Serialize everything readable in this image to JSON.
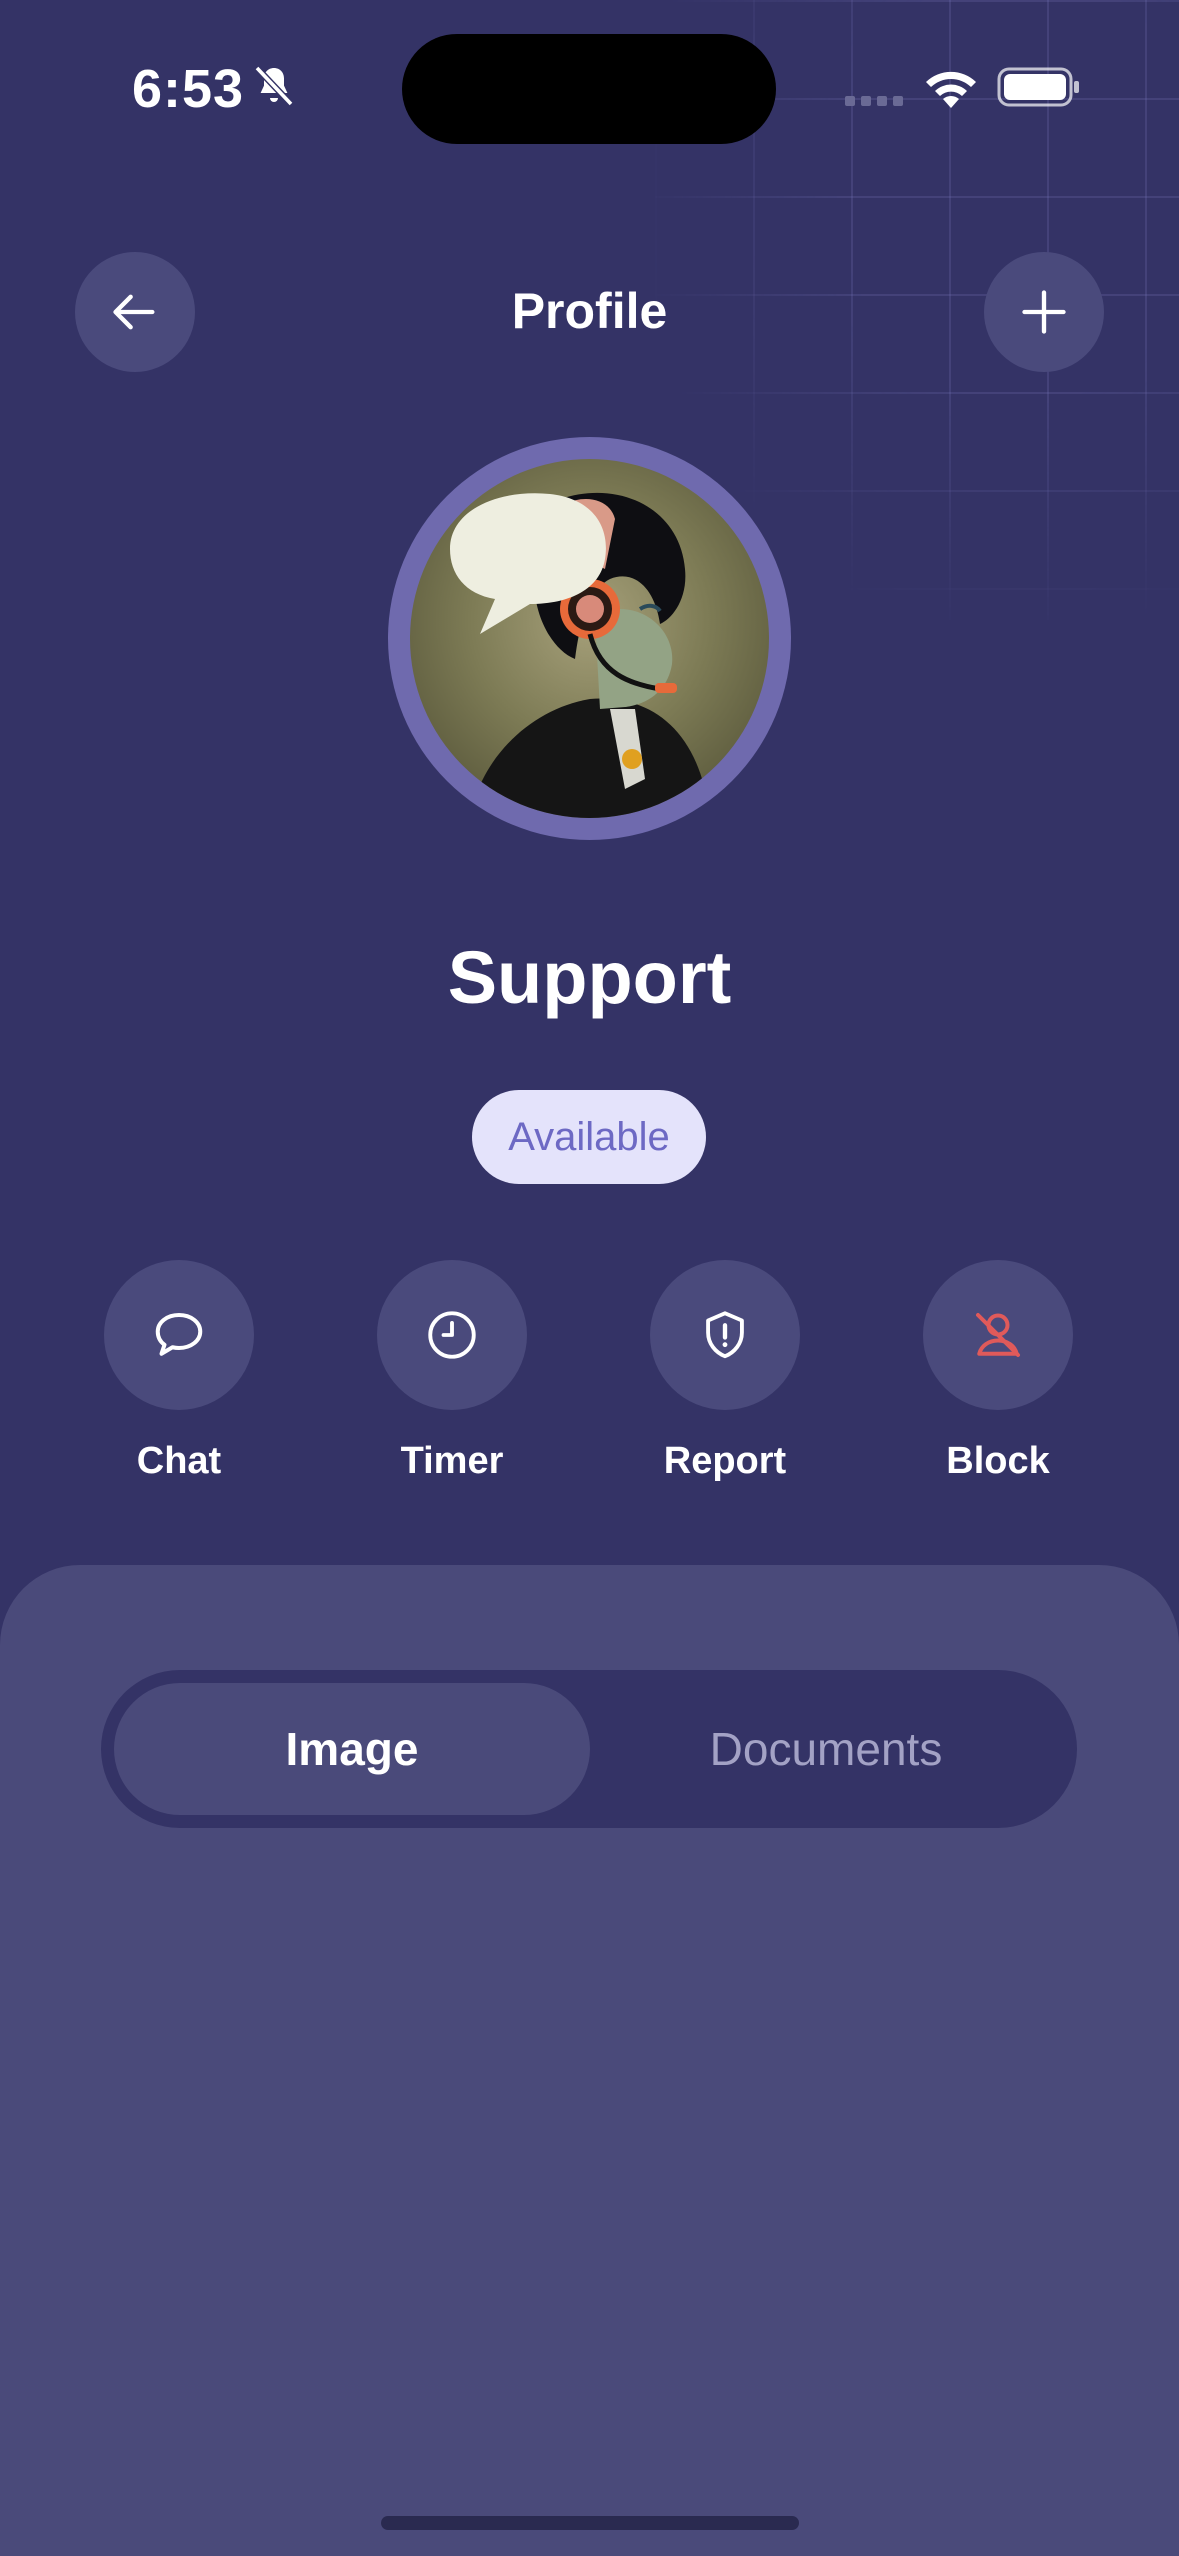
{
  "status_bar": {
    "time": "6:53",
    "icons": [
      "bell-slash-icon",
      "cellular-signal-icon",
      "wifi-icon",
      "battery-icon"
    ]
  },
  "header": {
    "title": "Profile",
    "back_icon": "arrow-left-icon",
    "add_icon": "plus-icon"
  },
  "profile": {
    "name": "Support",
    "status": "Available"
  },
  "actions": [
    {
      "label": "Chat",
      "icon": "chat-bubble-icon"
    },
    {
      "label": "Timer",
      "icon": "clock-icon"
    },
    {
      "label": "Report",
      "icon": "shield-alert-icon"
    },
    {
      "label": "Block",
      "icon": "user-blocked-icon"
    }
  ],
  "tabs": {
    "items": [
      {
        "label": "Image",
        "selected": true
      },
      {
        "label": "Documents",
        "selected": false
      }
    ]
  },
  "colors": {
    "background": "#343366",
    "card": "#4a4a7a",
    "accent": "#6f6aae",
    "badge_bg": "#e4e3fb",
    "badge_text": "#6d69c4",
    "danger": "#e05a5a"
  }
}
